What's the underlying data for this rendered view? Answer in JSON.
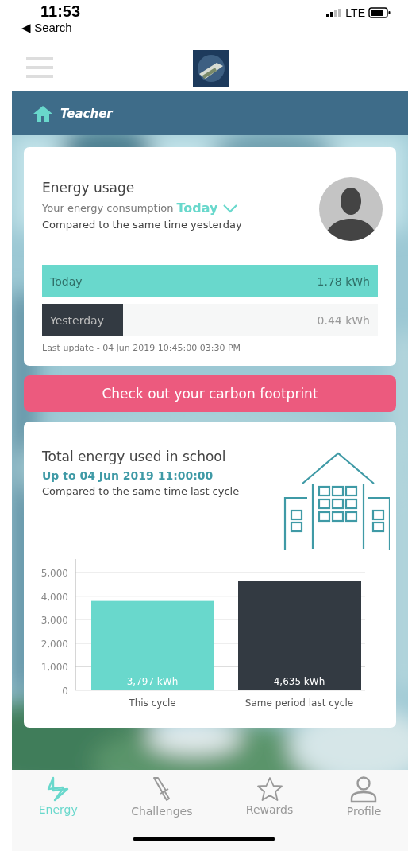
{
  "status_bar": {
    "time": "11:53",
    "back": "◀ Search",
    "network": "LTE"
  },
  "header": {
    "role": "Teacher"
  },
  "energy_card": {
    "title": "Energy usage",
    "subtitle": "Your energy consumption",
    "period": "Today",
    "compare": "Compared to the same time yesterday",
    "bars": [
      {
        "label": "Today",
        "reading": "1.78 kWh",
        "level": 1,
        "color": "#69d8cc"
      },
      {
        "label": "Yesterday",
        "reading": "0.44 kWh",
        "level": 0.24,
        "color": "#333a42"
      }
    ],
    "last_update": "Last update - 04 Jun 2019 10:45:00 03:30 PM"
  },
  "carbon_button": "Check out your carbon footprint",
  "school_card": {
    "title": "Total energy used in school",
    "date": "Up to 04 Jun 2019 11:00:00",
    "compare": "Compared to the same time last cycle",
    "chart_data": {
      "type": "bar",
      "categories": [
        "This cycle",
        "Same period last cycle"
      ],
      "stacked": true,
      "grid": true,
      "series": [
        {
          "color": "#69d8cc",
          "values": [
            3797,
            null
          ]
        },
        {
          "color": "#333a42",
          "values": [
            null,
            4635
          ]
        }
      ],
      "ylim": [
        0,
        5000
      ],
      "yticks": [
        {
          "value": 0,
          "label": "0"
        },
        {
          "value": 1000,
          "label": "1,000"
        },
        {
          "value": 2000,
          "label": "2,000"
        },
        {
          "value": 3000,
          "label": "3,000"
        },
        {
          "value": 4000,
          "label": "4,000"
        },
        {
          "value": 5000,
          "label": "5,000"
        }
      ],
      "value_labels": [
        "3,797 kWh",
        "4,635 kWh"
      ]
    }
  },
  "tabs": [
    {
      "kind": "energy",
      "label": "Energy",
      "selected": true
    },
    {
      "kind": "challenges",
      "label": "Challenges",
      "selected": false
    },
    {
      "kind": "rewards",
      "label": "Rewards",
      "selected": false
    },
    {
      "kind": "profile",
      "label": "Profile",
      "selected": false
    }
  ]
}
